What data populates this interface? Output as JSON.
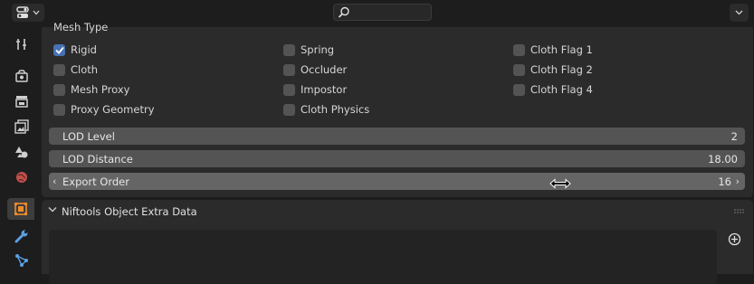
{
  "header": {
    "editor_type_icon": "properties-editor-icon",
    "search": {
      "placeholder": ""
    },
    "options_icon": "chevron-down-icon"
  },
  "tabs": [
    {
      "name": "tool",
      "icon": "tool-icon"
    },
    {
      "name": "render",
      "icon": "render-icon"
    },
    {
      "name": "output",
      "icon": "output-icon"
    },
    {
      "name": "view-layer",
      "icon": "view-layer-icon"
    },
    {
      "name": "scene",
      "icon": "scene-icon"
    },
    {
      "name": "world",
      "icon": "world-icon"
    },
    {
      "name": "object",
      "icon": "object-icon",
      "active": true
    },
    {
      "name": "modifiers",
      "icon": "wrench-icon"
    },
    {
      "name": "particles",
      "icon": "particles-icon"
    }
  ],
  "mesh_type": {
    "title": "Mesh Type",
    "col1": [
      {
        "label": "Rigid",
        "checked": true
      },
      {
        "label": "Cloth",
        "checked": false
      },
      {
        "label": "Mesh Proxy",
        "checked": false
      },
      {
        "label": "Proxy Geometry",
        "checked": false
      }
    ],
    "col2": [
      {
        "label": "Spring",
        "checked": false
      },
      {
        "label": "Occluder",
        "checked": false
      },
      {
        "label": "Impostor",
        "checked": false
      },
      {
        "label": "Cloth Physics",
        "checked": false
      }
    ],
    "col3": [
      {
        "label": "Cloth Flag 1",
        "checked": false
      },
      {
        "label": "Cloth Flag 2",
        "checked": false
      },
      {
        "label": "Cloth Flag 4",
        "checked": false
      }
    ]
  },
  "fields": {
    "lod_level": {
      "label": "LOD Level",
      "value": "2"
    },
    "lod_distance": {
      "label": "LOD Distance",
      "value": "18.00"
    },
    "export_order": {
      "label": "Export Order",
      "value": "16",
      "left_arrow": "‹",
      "right_arrow": "›"
    }
  },
  "extra_data_panel": {
    "title": "Niftools Object Extra Data",
    "add_icon": "add-icon"
  },
  "colors": {
    "accent": "#4772b3",
    "panel_bg": "#2b2b2b",
    "field_bg": "#545454",
    "active_tab_icon": "#f08c2a"
  }
}
